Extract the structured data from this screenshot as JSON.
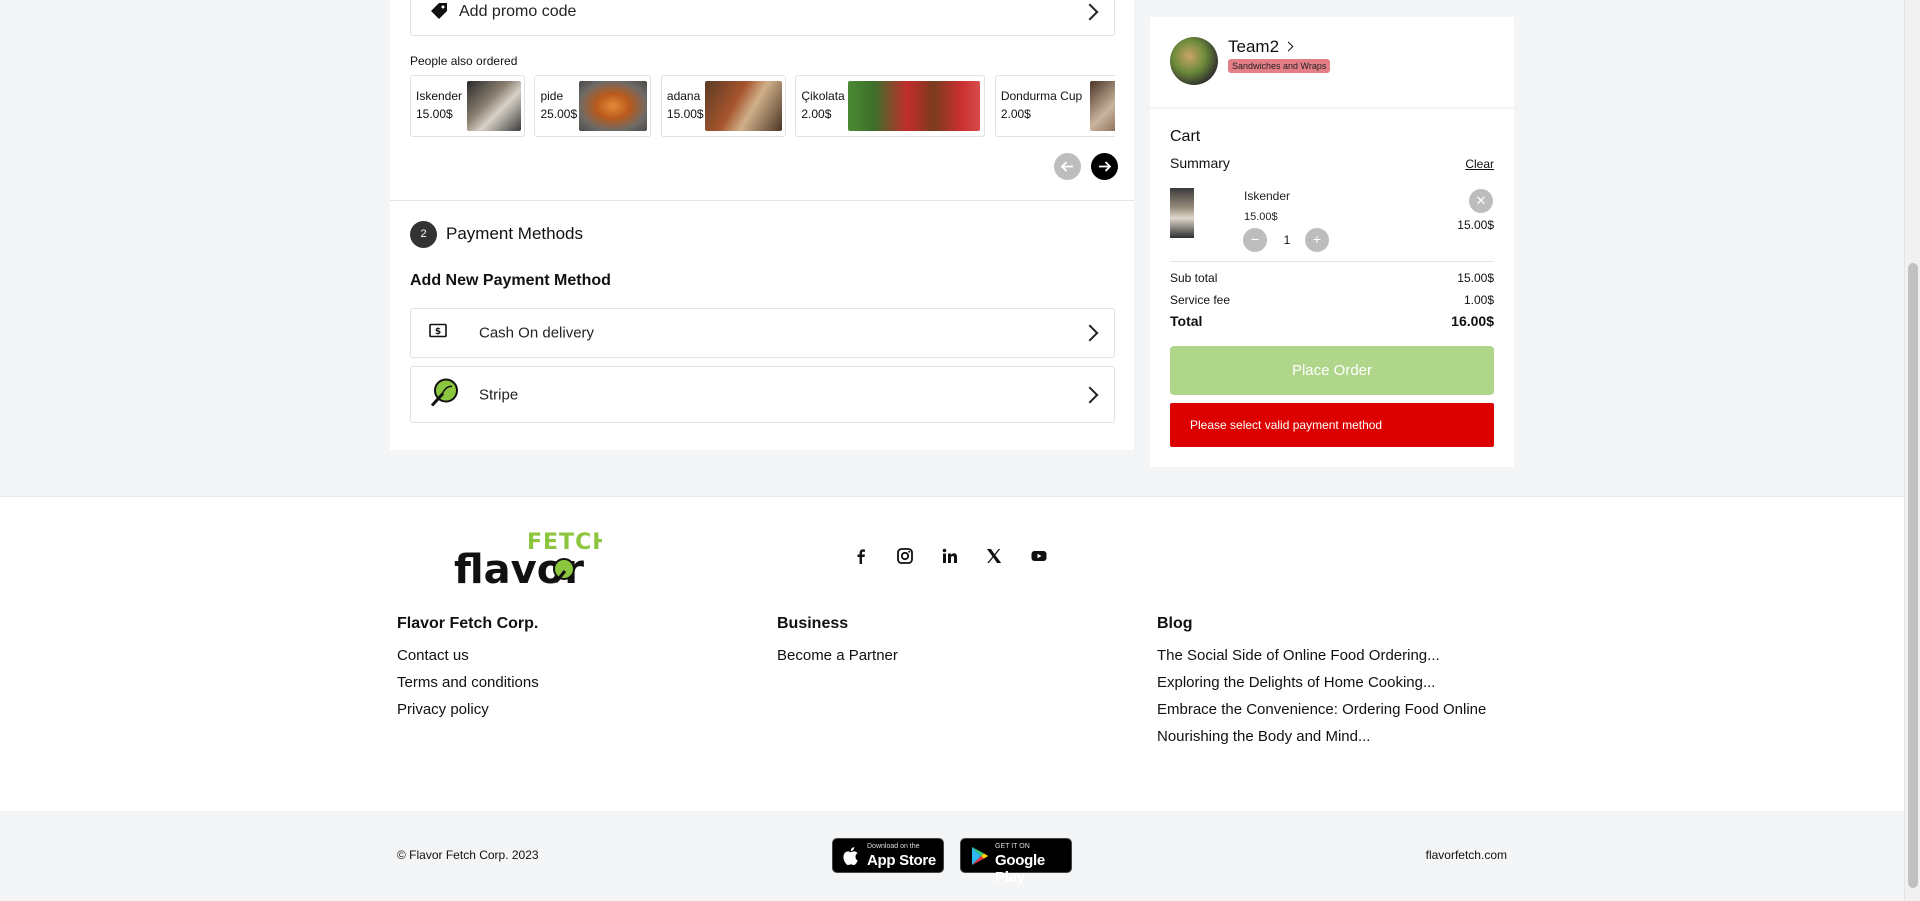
{
  "checkout": {
    "promo_label": "Add promo code",
    "people_also_ordered_title": "People also ordered",
    "suggestions": [
      {
        "name": "Iskender",
        "price": "15.00$"
      },
      {
        "name": "pide",
        "price": "25.00$"
      },
      {
        "name": "adana",
        "price": "15.00$"
      },
      {
        "name": "Çikolata",
        "price": "2.00$"
      },
      {
        "name": "Dondurma Cup",
        "price": "2.00$"
      }
    ],
    "step_number": "2",
    "payment_section_title": "Payment Methods",
    "add_payment_title": "Add New Payment Method",
    "payment_methods": [
      {
        "label": "Cash On delivery",
        "icon": "cash-icon"
      },
      {
        "label": "Stripe",
        "icon": "stripe-leaf-icon"
      }
    ]
  },
  "restaurant": {
    "name": "Team2",
    "category": "Sandwiches and Wraps"
  },
  "cart": {
    "title": "Cart",
    "summary_label": "Summary",
    "clear_label": "Clear",
    "item": {
      "name": "Iskender",
      "unit_price": "15.00$",
      "quantity": "1",
      "line_total": "15.00$"
    },
    "subtotal_label": "Sub total",
    "subtotal_value": "15.00$",
    "service_fee_label": "Service fee",
    "service_fee_value": "1.00$",
    "total_label": "Total",
    "total_value": "16.00$",
    "place_order_label": "Place Order",
    "error_message": "Please select valid payment method"
  },
  "footer": {
    "logo_top": "FETCH",
    "logo_bottom": "flavor",
    "columns": [
      {
        "heading": "Flavor Fetch Corp.",
        "links": [
          "Contact us",
          "Terms and conditions",
          "Privacy policy"
        ]
      },
      {
        "heading": "Business",
        "links": [
          "Become a Partner"
        ]
      },
      {
        "heading": "Blog",
        "links": [
          "The Social Side of Online Food Ordering...",
          "Exploring the Delights of Home Cooking...",
          "Embrace the Convenience: Ordering Food Online",
          "Nourishing the Body and Mind..."
        ]
      }
    ],
    "social_icons": [
      "facebook-icon",
      "instagram-icon",
      "linkedin-icon",
      "x-icon",
      "youtube-icon"
    ],
    "copyright": "© Flavor Fetch Corp. 2023",
    "app_store_small": "Download on the",
    "app_store_big": "App Store",
    "google_play_small": "GET IT ON",
    "google_play_big": "Google Play",
    "site_link": "flavorfetch.com"
  },
  "colors": {
    "accent_green": "#8cc63f",
    "place_order_disabled": "#b0d68c",
    "error_red": "#dd0000",
    "category_tag": "#e57f87"
  }
}
